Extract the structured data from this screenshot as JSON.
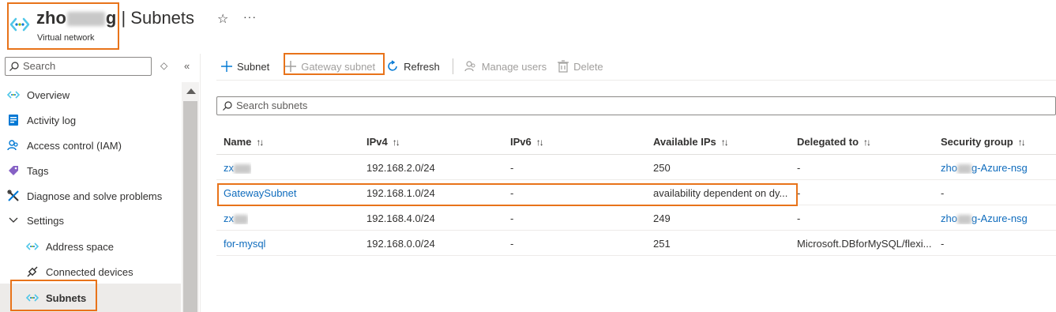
{
  "header": {
    "name_start": "zho",
    "name_end": "g",
    "separator": " | ",
    "page": "Subnets",
    "subtitle": "Virtual network",
    "star": "☆",
    "more": "···"
  },
  "sidebar": {
    "search_placeholder": "Search",
    "items": [
      {
        "label": "Overview",
        "icon": "virtual-network-icon"
      },
      {
        "label": "Activity log",
        "icon": "activity-log-icon"
      },
      {
        "label": "Access control (IAM)",
        "icon": "people-icon"
      },
      {
        "label": "Tags",
        "icon": "tag-icon"
      },
      {
        "label": "Diagnose and solve problems",
        "icon": "wrench-icon"
      },
      {
        "label": "Settings",
        "icon": "chevron-down-icon"
      },
      {
        "label": "Address space",
        "icon": "virtual-network-icon"
      },
      {
        "label": "Connected devices",
        "icon": "plug-icon"
      },
      {
        "label": "Subnets",
        "icon": "virtual-network-icon"
      }
    ]
  },
  "toolbar": {
    "subnet": "Subnet",
    "gateway_subnet": "Gateway subnet",
    "refresh": "Refresh",
    "manage_users": "Manage users",
    "delete": "Delete"
  },
  "search": {
    "placeholder": "Search subnets"
  },
  "table": {
    "columns": [
      "Name",
      "IPv4",
      "IPv6",
      "Available IPs",
      "Delegated to",
      "Security group"
    ],
    "sort_glyph": "↑↓",
    "rows": [
      {
        "name": "zx",
        "ipv4": "192.168.2.0/24",
        "ipv6": "-",
        "available": "250",
        "delegated": "-",
        "nsg_start": "zho",
        "nsg_end": "g-Azure-nsg"
      },
      {
        "name": "GatewaySubnet",
        "ipv4": "192.168.1.0/24",
        "ipv6": "-",
        "available": "availability dependent on dy...",
        "delegated": "-",
        "nsg": "-"
      },
      {
        "name": "zx",
        "ipv4": "192.168.4.0/24",
        "ipv6": "-",
        "available": "249",
        "delegated": "-",
        "nsg_start": "zho",
        "nsg_end": "g-Azure-nsg"
      },
      {
        "name": "for-mysql",
        "ipv4": "192.168.0.0/24",
        "ipv6": "-",
        "available": "251",
        "delegated": "Microsoft.DBforMySQL/flexi...",
        "nsg": "-"
      }
    ]
  },
  "colors": {
    "accent": "#0f6cbd",
    "highlight": "#e8731a"
  }
}
